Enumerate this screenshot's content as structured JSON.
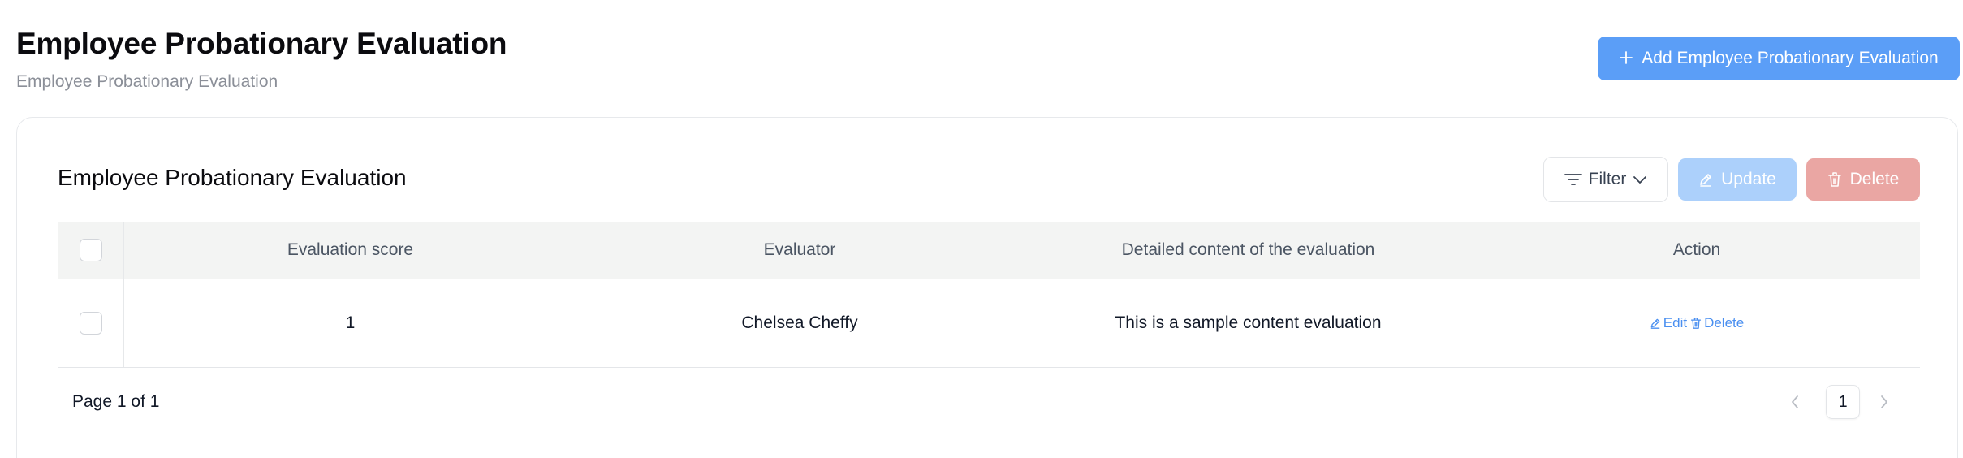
{
  "header": {
    "title": "Employee Probationary Evaluation",
    "subtitle": "Employee Probationary Evaluation",
    "add_button_label": "Add Employee Probationary Evaluation"
  },
  "card": {
    "title": "Employee Probationary Evaluation",
    "filter_label": "Filter",
    "update_label": "Update",
    "delete_label": "Delete"
  },
  "table": {
    "columns": [
      "Evaluation score",
      "Evaluator",
      "Detailed content of the evaluation",
      "Action"
    ],
    "rows": [
      {
        "score": "1",
        "evaluator": "Chelsea Cheffy",
        "detail": "This is a sample content evaluation",
        "edit_label": "Edit",
        "delete_label": "Delete"
      }
    ]
  },
  "pagination": {
    "info": "Page 1 of 1",
    "current_page": "1"
  },
  "colors": {
    "primary": "#5b9ef7",
    "update_disabled": "#acd0fb",
    "delete_disabled": "#eaa6a3",
    "link": "#4a8ff0",
    "header_bg": "#f3f4f3"
  },
  "icons": {
    "add": "plus-icon",
    "filter": "filter-icon",
    "dropdown": "chevron-down-icon",
    "update": "pencil-icon",
    "delete": "trash-icon",
    "prev": "chevron-left-icon",
    "next": "chevron-right-icon"
  }
}
